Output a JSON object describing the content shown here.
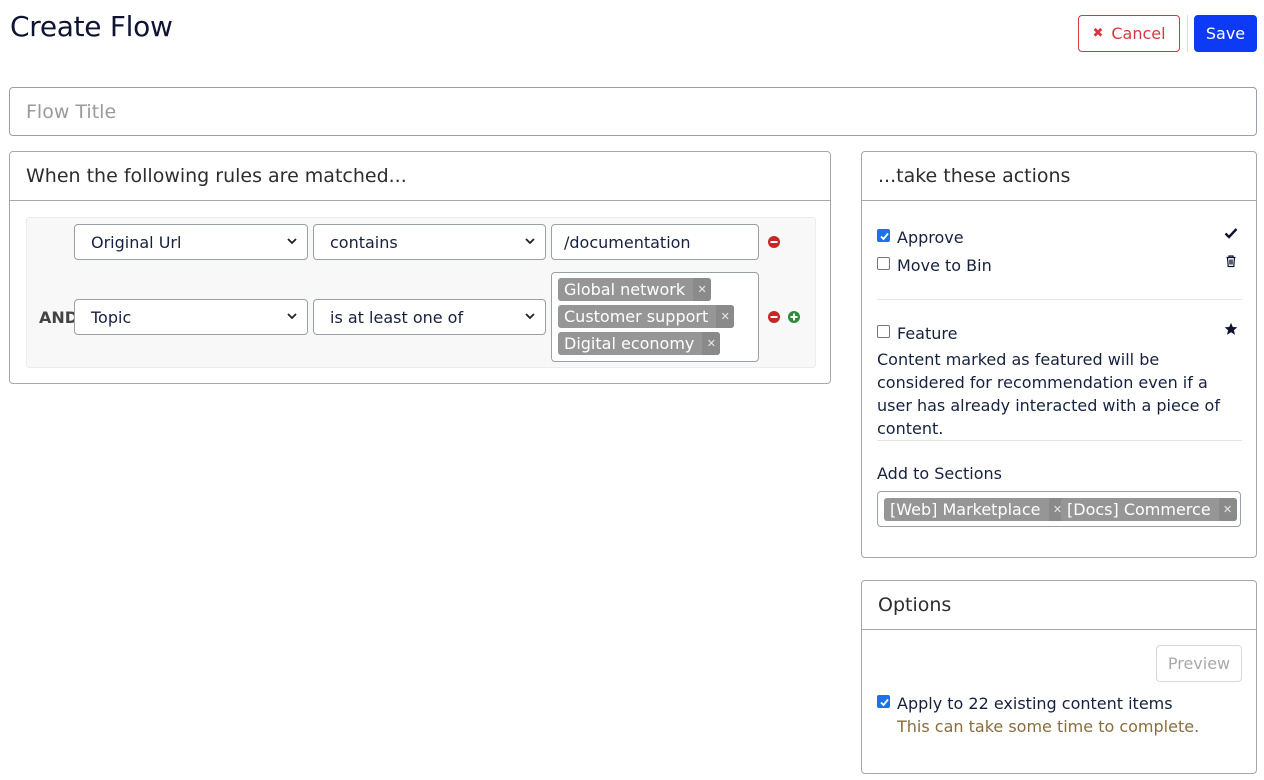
{
  "header": {
    "title": "Create Flow",
    "cancel_label": "Cancel",
    "save_label": "Save"
  },
  "flow_title": {
    "placeholder": "Flow Title",
    "value": ""
  },
  "rules": {
    "heading": "When the following rules are matched...",
    "conjunction": "AND",
    "rows": [
      {
        "field": "Original Url",
        "operator": "contains",
        "value": "/documentation"
      },
      {
        "field": "Topic",
        "operator": "is at least one of",
        "tags": [
          "Global network",
          "Customer support",
          "Digital economy"
        ]
      }
    ]
  },
  "actions": {
    "heading": "...take these actions",
    "approve": {
      "label": "Approve",
      "checked": true,
      "icon": "check-icon"
    },
    "move_to_bin": {
      "label": "Move to Bin",
      "checked": false,
      "icon": "trash-icon"
    },
    "feature": {
      "label": "Feature",
      "checked": false,
      "icon": "star-icon",
      "description": "Content marked as featured will be considered for recommendation even if a user has already interacted with a piece of content."
    },
    "sections": {
      "label": "Add to Sections",
      "tags": [
        "[Web] Marketplace",
        "[Docs] Commerce"
      ]
    }
  },
  "options": {
    "heading": "Options",
    "preview_label": "Preview",
    "apply": {
      "label": "Apply to 22 existing content items",
      "checked": true
    },
    "hint": "This can take some time to complete."
  },
  "colors": {
    "primary": "#0d3bf5",
    "danger": "#d9363e",
    "tag": "#969696",
    "add": "#2e8b3a",
    "hint": "#8a6d3b"
  }
}
